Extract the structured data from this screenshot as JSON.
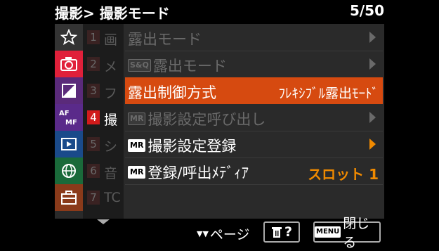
{
  "header": {
    "breadcrumb": "撮影> 撮影モード",
    "page": "5/50"
  },
  "tabs": [
    {
      "icon": "star-icon",
      "active": false
    },
    {
      "icon": "camera-icon",
      "active": true
    },
    {
      "icon": "exposure-icon",
      "active": false
    },
    {
      "icon": "af-mf-icon",
      "active": false
    },
    {
      "icon": "playback-icon",
      "active": false
    },
    {
      "icon": "network-icon",
      "active": false
    },
    {
      "icon": "toolbox-icon",
      "active": false
    }
  ],
  "subtabs": [
    {
      "num": "1",
      "label": "画",
      "active": false
    },
    {
      "num": "2",
      "label": "メ",
      "active": false
    },
    {
      "num": "3",
      "label": "フ",
      "active": false
    },
    {
      "num": "4",
      "label": "撮",
      "active": true
    },
    {
      "num": "5",
      "label": "シ",
      "active": false
    },
    {
      "num": "6",
      "label": "音",
      "active": false
    },
    {
      "num": "7",
      "label": "TC",
      "active": false
    }
  ],
  "items": [
    {
      "label": "露出モード",
      "badge": "",
      "value": ""
    },
    {
      "label": "露出モード",
      "badge": "S&Q",
      "value": ""
    },
    {
      "label": "露出制御方式",
      "badge": "",
      "value": "ﾌﾚｷｼﾌﾞﾙ露出ﾓｰﾄﾞ"
    },
    {
      "label": "撮影設定呼び出し",
      "badge": "MR",
      "value": ""
    },
    {
      "label": "撮影設定登録",
      "badge": "MR",
      "value": ""
    },
    {
      "label": "登録/呼出ﾒﾃﾞｨｱ",
      "badge": "MR",
      "value": "スロット 1"
    }
  ],
  "footer": {
    "page_key": "▼▼",
    "page_label": "ページ",
    "delete_label": "?",
    "menu_key": "MENU",
    "close_label": "閉じる"
  },
  "colors": {
    "accent": "#d64a10",
    "active_tab": "#d11b1b",
    "value": "#f08a00"
  }
}
